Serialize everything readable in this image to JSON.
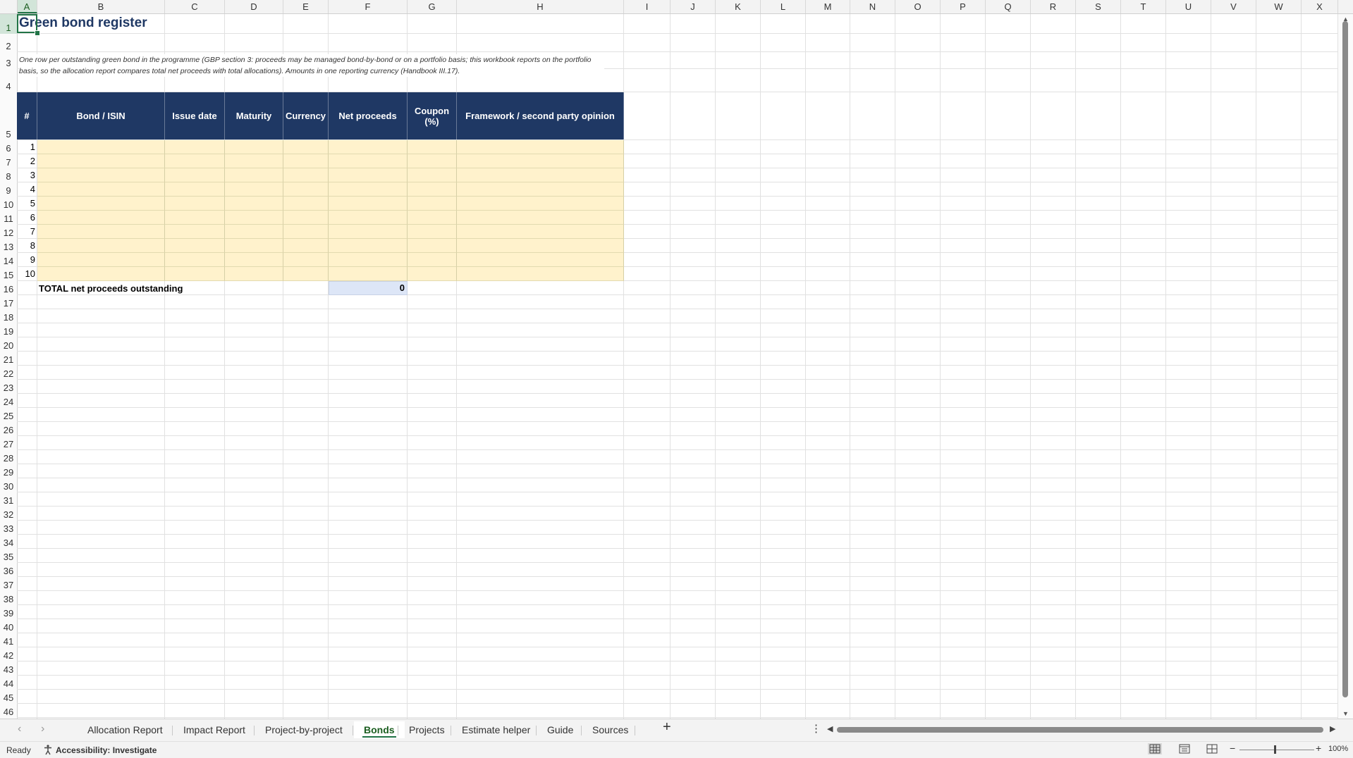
{
  "app": {
    "name_box_selection": "A1",
    "status": "Ready",
    "accessibility": "Accessibility: Investigate",
    "zoom": "100%"
  },
  "columns": [
    "A",
    "B",
    "C",
    "D",
    "E",
    "F",
    "G",
    "H",
    "I",
    "J",
    "K",
    "L",
    "M",
    "N",
    "O",
    "P",
    "Q",
    "R",
    "S",
    "T",
    "U",
    "V",
    "W",
    "X"
  ],
  "rows": [
    "1",
    "2",
    "3",
    "4",
    "5",
    "6",
    "7",
    "8",
    "9",
    "10",
    "11",
    "12",
    "13",
    "14",
    "15",
    "16",
    "17",
    "18",
    "19",
    "20",
    "21",
    "22",
    "23",
    "24",
    "25",
    "26",
    "27",
    "28",
    "29",
    "30",
    "31",
    "32",
    "33",
    "34",
    "35",
    "36",
    "37",
    "38",
    "39",
    "40",
    "41",
    "42",
    "43",
    "44",
    "45",
    "46"
  ],
  "sheet": {
    "title": "Green bond register",
    "description": "One row per outstanding green bond in the programme (GBP section 3: proceeds may be managed bond-by-bond or on a portfolio basis; this workbook reports on the portfolio basis, so the allocation report compares total net proceeds with total allocations). Amounts in one reporting currency (Handbook III.17).",
    "headers": [
      "#",
      "Bond / ISIN",
      "Issue date",
      "Maturity",
      "Currency",
      "Net proceeds",
      "Coupon (%)",
      "Framework / second party opinion"
    ],
    "row_numbers": [
      "1",
      "2",
      "3",
      "4",
      "5",
      "6",
      "7",
      "8",
      "9",
      "10"
    ],
    "total_label": "TOTAL net proceeds outstanding",
    "total_value": "0"
  },
  "tabs": [
    {
      "label": "Allocation Report",
      "active": false
    },
    {
      "label": "Impact Report",
      "active": false
    },
    {
      "label": "Project-by-project",
      "active": false
    },
    {
      "label": "Bonds",
      "active": true
    },
    {
      "label": "Projects",
      "active": false
    },
    {
      "label": "Estimate helper",
      "active": false
    },
    {
      "label": "Guide",
      "active": false
    },
    {
      "label": "Sources",
      "active": false
    }
  ],
  "icons": {
    "prev_sheet": "chevron-left-icon",
    "next_sheet": "chevron-right-icon",
    "add_sheet": "plus-icon",
    "more": "vertical-dots-icon",
    "accessibility": "accessibility-icon",
    "normal_view": "grid-view-icon",
    "page_layout": "page-layout-icon",
    "page_break": "page-break-icon"
  },
  "colors": {
    "header_fill": "#1f3864",
    "input_fill": "#fff2cc",
    "total_fill": "#dde6f7",
    "accent": "#217346"
  }
}
